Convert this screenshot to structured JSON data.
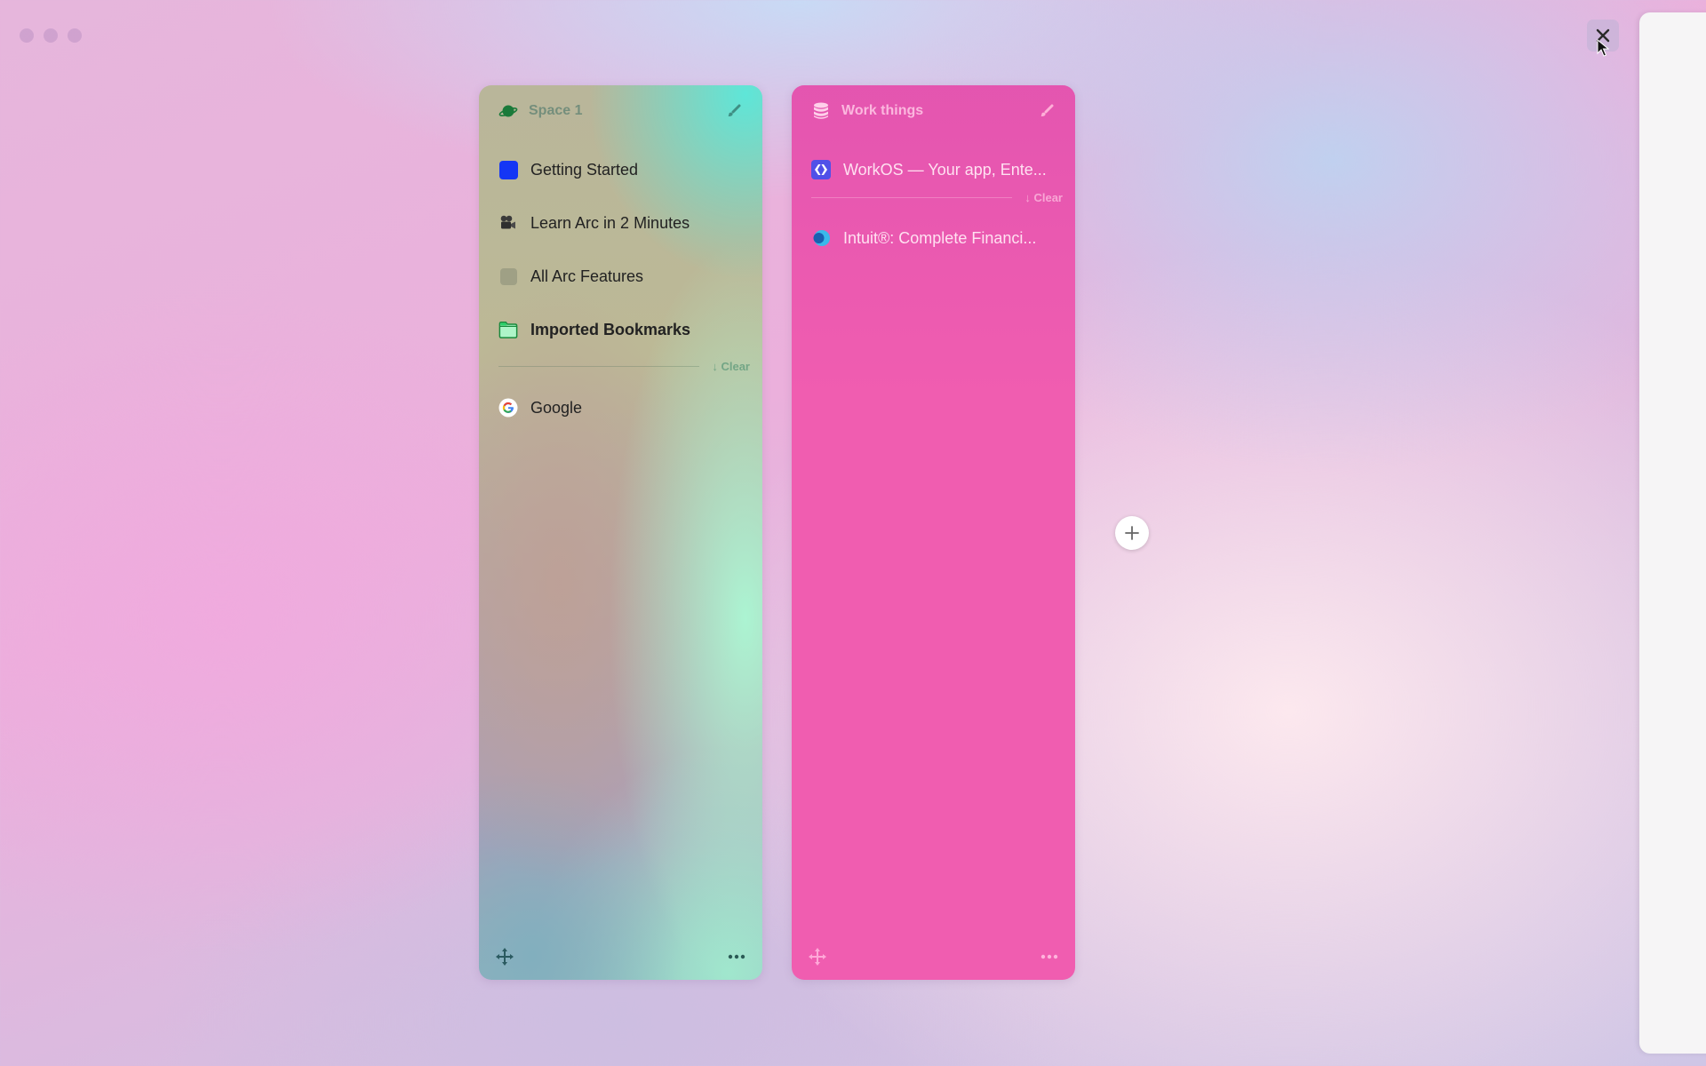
{
  "window": {
    "traffic_lights": [
      "close",
      "minimize",
      "zoom"
    ],
    "close_overlay_icon": "close-x-icon"
  },
  "spaces": [
    {
      "name": "Space 1",
      "icon": "planet-icon",
      "edit_icon": "paintbrush-icon",
      "pinned": [
        {
          "label": "Getting Started",
          "icon": "blue-square-icon",
          "bold": false
        },
        {
          "label": "Learn Arc in 2 Minutes",
          "icon": "movie-camera-icon",
          "bold": false
        },
        {
          "label": "All Arc Features",
          "icon": "gray-square-icon",
          "bold": false
        },
        {
          "label": "Imported Bookmarks",
          "icon": "folder-icon",
          "bold": true
        }
      ],
      "clear_label": "↓ Clear",
      "today": [
        {
          "label": "Google",
          "icon": "google-icon"
        }
      ],
      "footer": {
        "move_icon": "move-arrows-icon",
        "more_icon": "more-dots-icon"
      },
      "colors": {
        "accent": "#5ee6d8",
        "icon": "#1a7a3a"
      }
    },
    {
      "name": "Work things",
      "icon": "database-stack-icon",
      "edit_icon": "paintbrush-icon",
      "pinned": [
        {
          "label": "WorkOS — Your app, Ente...",
          "icon": "workos-icon",
          "bold": false
        }
      ],
      "clear_label": "↓ Clear",
      "today": [
        {
          "label": "Intuit®: Complete Financi...",
          "icon": "intuit-icon"
        }
      ],
      "footer": {
        "move_icon": "move-arrows-icon",
        "more_icon": "more-dots-icon"
      },
      "colors": {
        "accent": "#f05db0"
      }
    }
  ],
  "add_space_button": {
    "icon": "plus-icon"
  }
}
